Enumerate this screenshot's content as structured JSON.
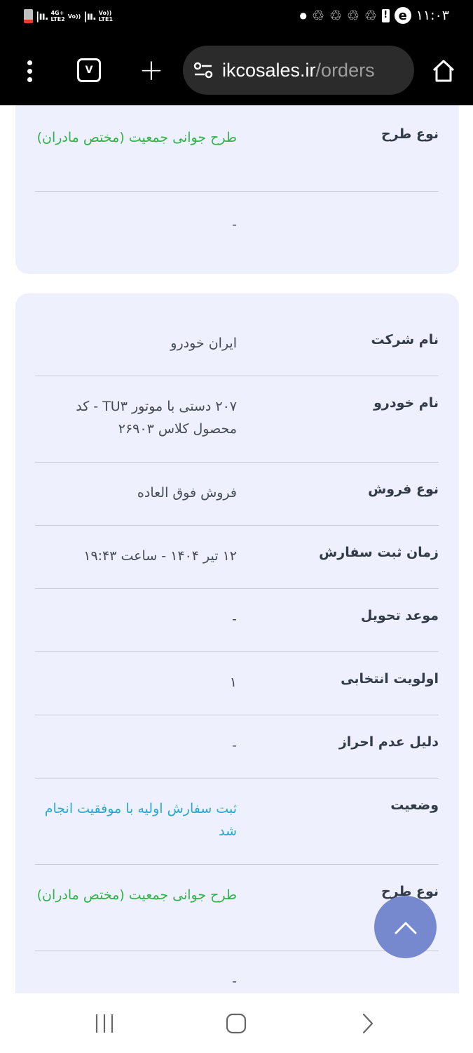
{
  "status_bar": {
    "network_1": "4G+",
    "network_1_sub": "LTE2",
    "volte_1": "Vo))",
    "network_2_sub": "LTE1",
    "volte_2": "Vo))",
    "time": "۱۱:۰۳"
  },
  "browser": {
    "tab_count": "V",
    "url_domain": "ikcosales.ir",
    "url_path": "/orders"
  },
  "top_card": {
    "rows": [
      {
        "label": "نوع طرح",
        "value": "طرح جوانی جمعیت (مختص مادران)"
      },
      {
        "label": "",
        "value": "-"
      }
    ]
  },
  "order_card": {
    "rows": [
      {
        "label": "نام شرکت",
        "value": "ایران خودرو"
      },
      {
        "label": "نام خودرو",
        "value": "۲۰۷ دستی با موتور TU۳ - کد محصول کلاس ۲۶۹۰۳"
      },
      {
        "label": "نوع فروش",
        "value": "فروش فوق العاده"
      },
      {
        "label": "زمان ثبت سفارش",
        "value": "۱۲ تیر ۱۴۰۴ - ساعت ۱۹:۴۳"
      },
      {
        "label": "موعد تحویل",
        "value": "-"
      },
      {
        "label": "اولویت انتخابی",
        "value": "۱"
      },
      {
        "label": "دلیل عدم احراز",
        "value": "-"
      },
      {
        "label": "وضعیت",
        "value": "ثبت سفارش اولیه با موفقیت انجام شد"
      },
      {
        "label": "نوع طرح",
        "value": "طرح جوانی جمعیت (مختص مادران)"
      },
      {
        "label": "",
        "value": "-"
      }
    ]
  },
  "colors": {
    "card_bg": "#eef1fd",
    "green_value": "#2fb24a",
    "status_blue": "#2aa7cf",
    "fab_bg": "#7689cf"
  }
}
